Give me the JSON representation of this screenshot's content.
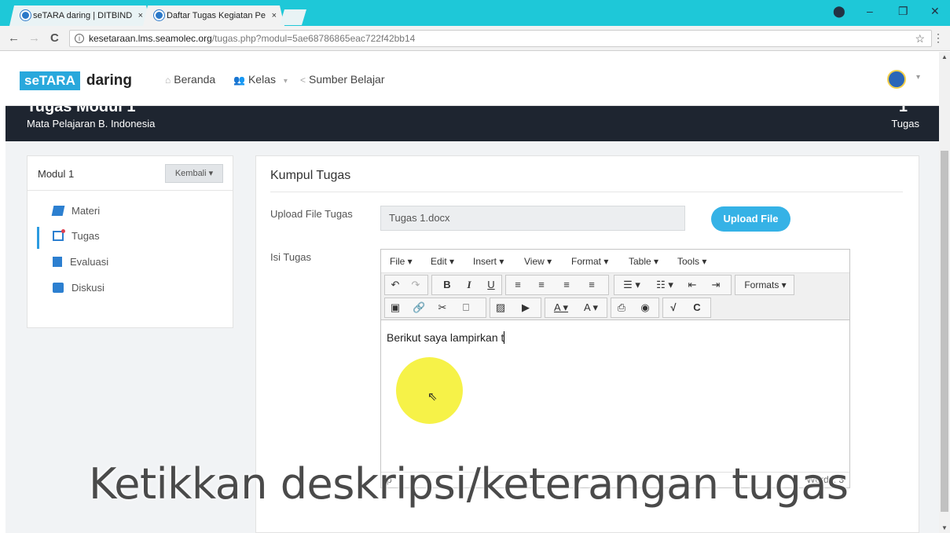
{
  "browser": {
    "tabs": [
      {
        "title": "seTARA daring | DITBIND",
        "active": false
      },
      {
        "title": "Daftar Tugas Kegiatan Pe",
        "active": true
      }
    ],
    "tab_close": "×",
    "url_host": "kesetaraan.lms.seamolec.org",
    "url_path": "/tugas.php?modul=5ae68786865eac722f42bb14",
    "back": "←",
    "forward": "→",
    "reload": "C",
    "info": "i",
    "bookmark": "☆",
    "menu": "⋮",
    "window_controls": {
      "account": "⬤",
      "minimize": "–",
      "maximize": "❐",
      "close": "✕"
    }
  },
  "site": {
    "logo_box": "seTARA",
    "logo_word": "daring",
    "nav": [
      {
        "label": "Beranda",
        "icon": "home-icon"
      },
      {
        "label": "Kelas",
        "icon": "users-icon",
        "caret": "▾"
      },
      {
        "label": "Sumber Belajar",
        "icon": "share-icon"
      }
    ],
    "avatar_caret": "▾"
  },
  "header": {
    "title": "Tugas Modul 1",
    "subtitle": "Mata Pelajaran B. Indonesia",
    "right_label": "Tugas",
    "right_number": "1"
  },
  "sidebar": {
    "module": "Modul 1",
    "back_button": "Kembali ▾",
    "items": [
      {
        "label": "Materi",
        "icon": "book-icon",
        "active": false
      },
      {
        "label": "Tugas",
        "icon": "task-icon",
        "active": true
      },
      {
        "label": "Evaluasi",
        "icon": "clipboard-icon",
        "active": false
      },
      {
        "label": "Diskusi",
        "icon": "chat-icon",
        "active": false
      }
    ]
  },
  "form": {
    "title": "Kumpul Tugas",
    "upload_label": "Upload File Tugas",
    "file_value": "Tugas 1.docx",
    "upload_button": "Upload File",
    "isi_label": "Isi Tugas"
  },
  "editor": {
    "menus": [
      "File ▾",
      "Edit ▾",
      "Insert ▾",
      "View ▾",
      "Format ▾",
      "Table ▾",
      "Tools ▾"
    ],
    "content": "Berikut saya lampirkan t",
    "status_path": "p",
    "word_count": "Words: 3",
    "formats_label": "Formats ▾"
  },
  "caption": "Ketikkan deskripsi/keterangan tugas",
  "colors": {
    "tabbar": "#1ec8d8",
    "brand_blue": "#29a8dc",
    "dark_header": "#1e2530",
    "upload_button": "#35b2e6",
    "highlight": "#f5f028"
  }
}
